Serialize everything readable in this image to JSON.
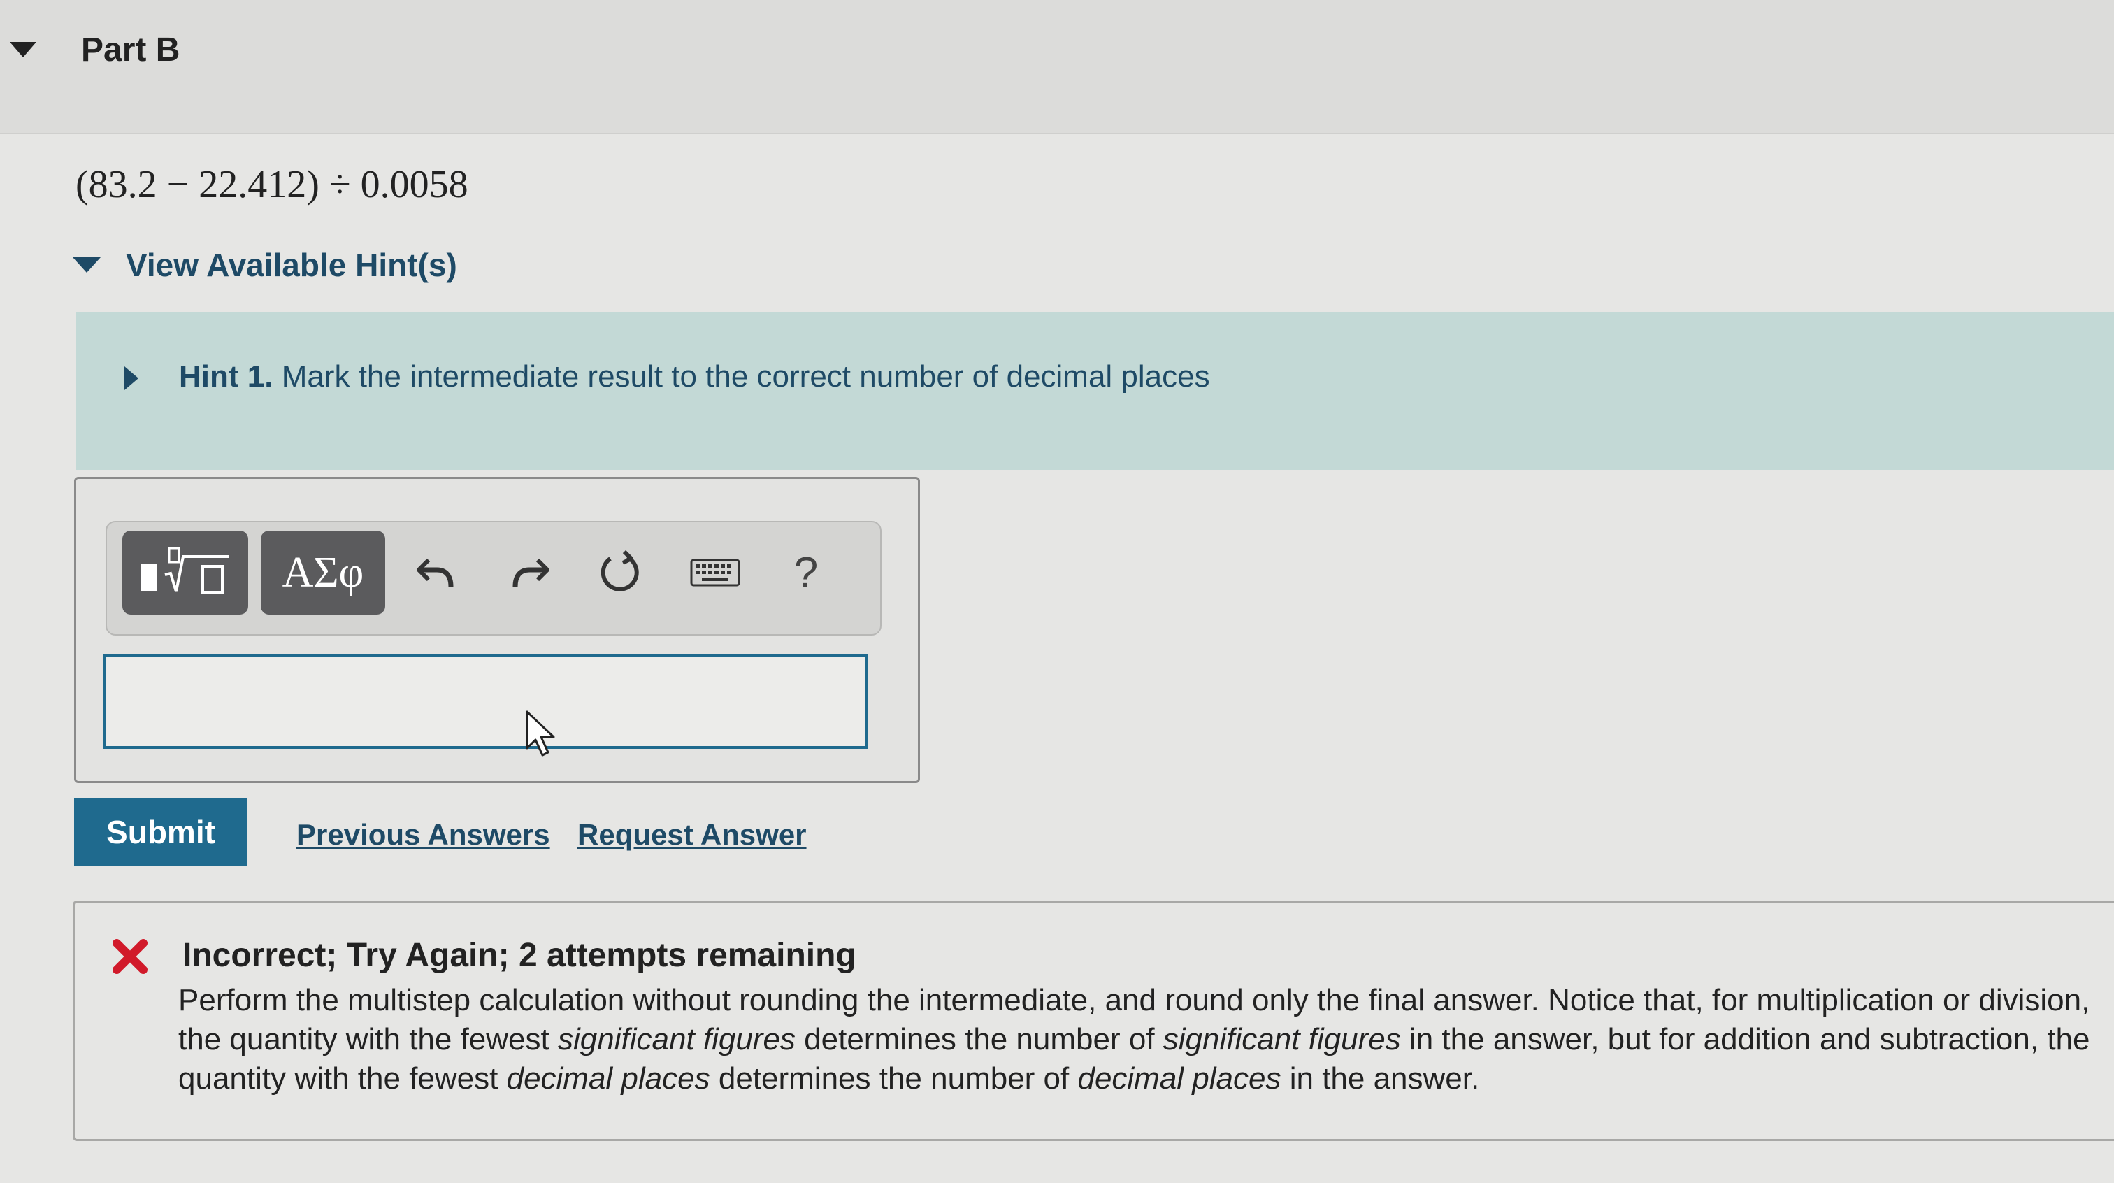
{
  "part": {
    "title": "Part B"
  },
  "question": {
    "equation": "(83.2 − 22.412) ÷ 0.0058"
  },
  "hints": {
    "toggle_label": "View Available Hint(s)",
    "items": [
      {
        "number_label": "Hint 1.",
        "text": "Mark the intermediate result to the correct number of decimal places"
      }
    ]
  },
  "toolbar": {
    "greek_label": "ΑΣφ",
    "help_label": "?",
    "icons": [
      "templates-icon",
      "undo-icon",
      "redo-icon",
      "reset-icon",
      "keyboard-icon",
      "help-icon"
    ]
  },
  "answer_input": {
    "value": ""
  },
  "actions": {
    "submit_label": "Submit",
    "previous_answers_label": "Previous Answers",
    "request_answer_label": "Request Answer"
  },
  "feedback": {
    "title": "Incorrect; Try Again; 2 attempts remaining",
    "body_1": "Perform the multistep calculation without rounding the intermediate, and round only the final answer. Notice that, for multiplication or division, the quantity with the fewest ",
    "em_1": "significant figures",
    "body_2": " determines the number of ",
    "em_2": "significant figures",
    "body_3": " in the answer, but for addition and subtraction, the quantity with the fewest ",
    "em_3": "decimal places",
    "body_4": " determines the number of ",
    "em_4": "decimal places",
    "body_5": " in the answer."
  },
  "colors": {
    "accent": "#1f6a8e",
    "link": "#1e4a66",
    "hint_panel": "#c3d9d6",
    "error": "#d11a2a"
  }
}
